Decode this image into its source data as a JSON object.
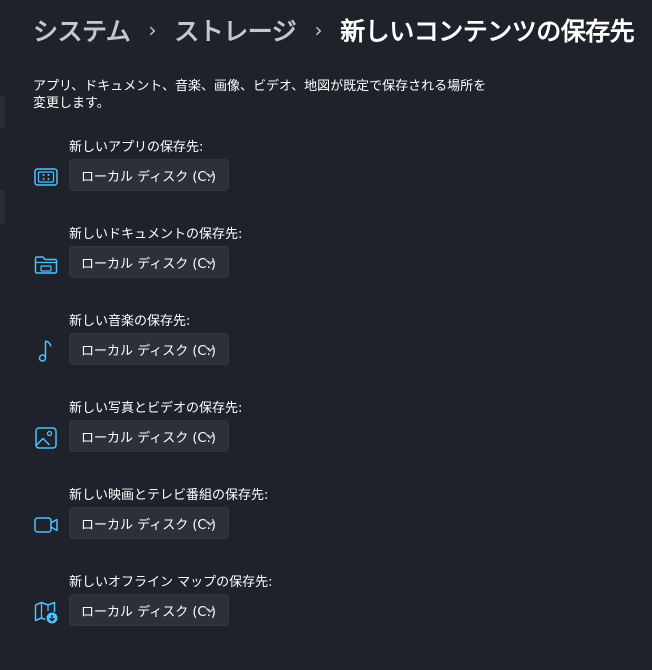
{
  "breadcrumb": {
    "items": [
      {
        "label": "システム"
      },
      {
        "label": "ストレージ"
      },
      {
        "label": "新しいコンテンツの保存先"
      }
    ],
    "separator": "›"
  },
  "description": "アプリ、ドキュメント、音楽、画像、ビデオ、地図が既定で保存される場所を変更します。",
  "settings": [
    {
      "label": "新しいアプリの保存先:",
      "value": "ローカル ディスク (C:)",
      "icon": "apps-icon"
    },
    {
      "label": "新しいドキュメントの保存先:",
      "value": "ローカル ディスク (C:)",
      "icon": "folder-icon"
    },
    {
      "label": "新しい音楽の保存先:",
      "value": "ローカル ディスク (C:)",
      "icon": "music-note-icon"
    },
    {
      "label": "新しい写真とビデオの保存先:",
      "value": "ローカル ディスク (C:)",
      "icon": "image-icon"
    },
    {
      "label": "新しい映画とテレビ番組の保存先:",
      "value": "ローカル ディスク (C:)",
      "icon": "video-camera-icon"
    },
    {
      "label": "新しいオフライン マップの保存先:",
      "value": "ローカル ディスク (C:)",
      "icon": "map-download-icon"
    }
  ],
  "colors": {
    "background": "#1f222b",
    "accent_icon": "#4cc2ff",
    "dropdown_bg": "#2d3039",
    "breadcrumb_parent": "#c5c7ce"
  }
}
